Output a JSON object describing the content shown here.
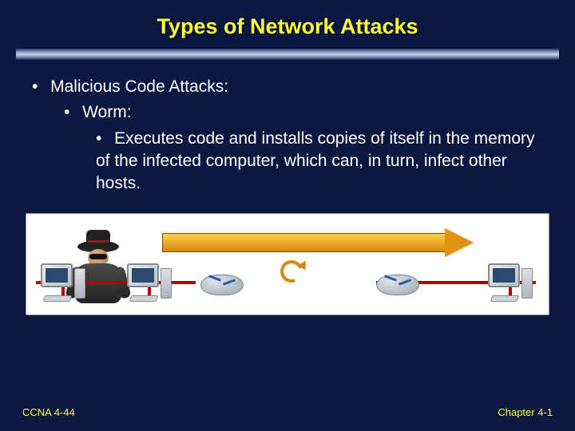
{
  "title": "Types of Network Attacks",
  "bullets": {
    "lvl1": "Malicious Code Attacks:",
    "lvl2": "Worm:",
    "lvl3": "Executes code and installs copies of itself in the memory of the infected computer, which can, in turn, infect other hosts."
  },
  "footer": {
    "left": "CCNA 4-44",
    "right": "Chapter 4-1"
  }
}
